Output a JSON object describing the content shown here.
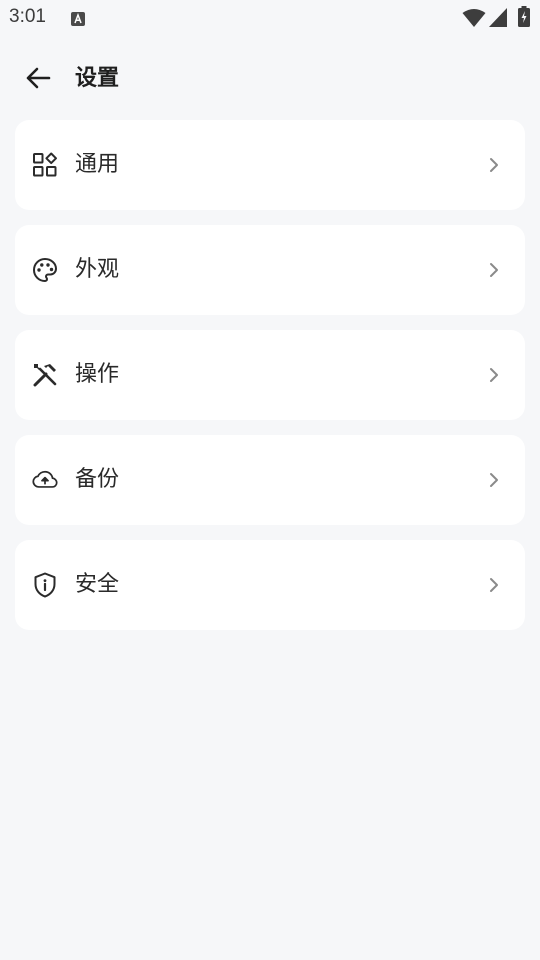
{
  "status_bar": {
    "time": "3:01",
    "notification_icon": "a-notification-icon",
    "wifi_icon": "wifi-icon",
    "signal_icon": "cell-signal-icon",
    "battery_icon": "battery-charging-icon"
  },
  "toolbar": {
    "back_icon": "arrow-left-icon",
    "title": "设置"
  },
  "menu": {
    "items": [
      {
        "label": "通用",
        "icon": "widgets-icon"
      },
      {
        "label": "外观",
        "icon": "palette-icon"
      },
      {
        "label": "操作",
        "icon": "tools-icon"
      },
      {
        "label": "备份",
        "icon": "cloud-upload-icon"
      },
      {
        "label": "安全",
        "icon": "shield-info-icon"
      }
    ],
    "chevron_icon": "chevron-right-icon"
  },
  "colors": {
    "background": "#f6f7f9",
    "card": "#ffffff",
    "icon": "#2b2b2b",
    "chevron": "#8a8a8a"
  }
}
